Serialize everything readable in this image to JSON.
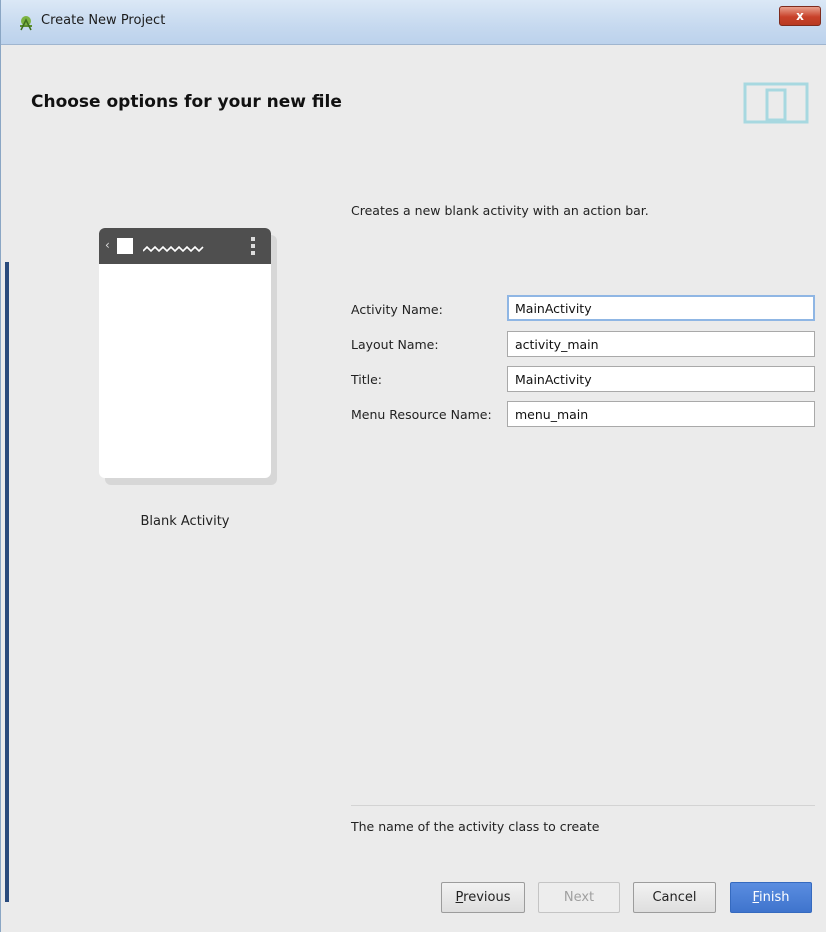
{
  "window": {
    "title": "Create New Project",
    "close_label": "x"
  },
  "page": {
    "heading": "Choose options for your new file",
    "description": "Creates a new blank activity with an action bar."
  },
  "template_preview": {
    "label": "Blank Activity"
  },
  "form": {
    "activity_name": {
      "label": "Activity Name:",
      "value": "MainActivity"
    },
    "layout_name": {
      "label": "Layout Name:",
      "value": "activity_main"
    },
    "title": {
      "label": "Title:",
      "value": "MainActivity"
    },
    "menu_resource_name": {
      "label": "Menu Resource Name:",
      "value": "menu_main"
    }
  },
  "hint": "The name of the activity class to create",
  "buttons": {
    "previous": {
      "mnemonic": "P",
      "rest": "revious"
    },
    "next": "Next",
    "cancel": "Cancel",
    "finish": {
      "mnemonic": "F",
      "rest": "inish"
    }
  },
  "colors": {
    "accent": "#3f74cd",
    "header_icon": "#9fd3dc",
    "preview_bar": "#4f4f4f"
  },
  "icons": {
    "title": "android-studio-icon",
    "header": "device-icon"
  }
}
